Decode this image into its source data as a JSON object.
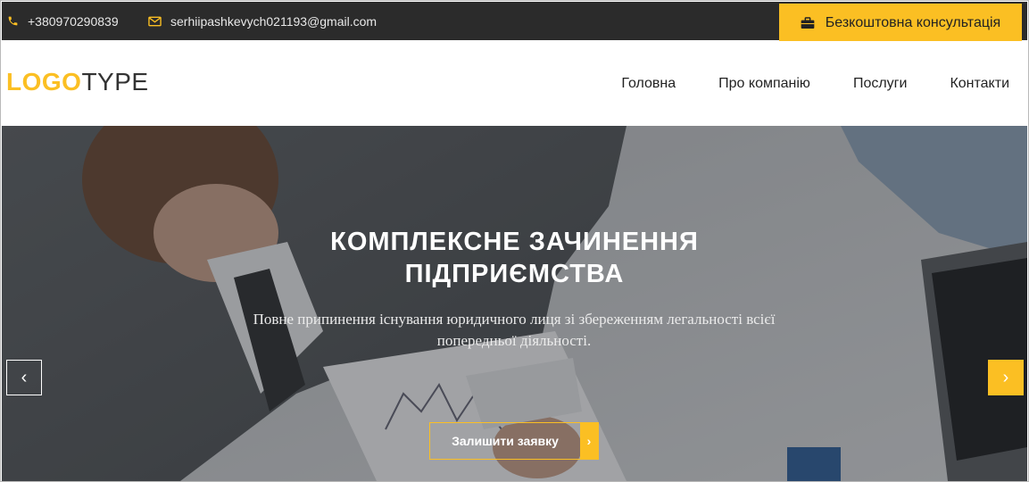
{
  "topbar": {
    "phone": "+380970290839",
    "email": "serhiipashkevych021193@gmail.com",
    "cta_label": "Безкоштовна консультація",
    "phone_icon": "phone-icon",
    "email_icon": "envelope-icon",
    "cta_icon": "briefcase-icon"
  },
  "header": {
    "logo_bold": "LOGO",
    "logo_light": "TYPE",
    "nav": [
      "Головна",
      "Про компанію",
      "Послуги",
      "Контакти"
    ]
  },
  "hero": {
    "title_line1": "КОМПЛЕКСНЕ ЗАЧИНЕННЯ",
    "title_line2": "ПІДПРИЄМСТВА",
    "subtitle": "Повне припинення існування юридичного лиця зі збереженням легальності всієї попередньої діяльності.",
    "cta_label": "Залишити заявку",
    "prev_arrow": "‹",
    "next_arrow": "›",
    "cta_arrow": "›"
  },
  "colors": {
    "accent": "#fbbf23",
    "topbar_bg": "#2b2b2b",
    "text_dark": "#222222"
  }
}
